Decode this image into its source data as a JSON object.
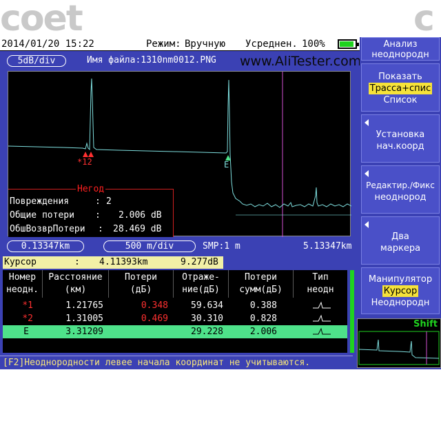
{
  "watermark": {
    "left": "coet",
    "right": "c"
  },
  "status": {
    "datetime": "2014/01/20 15:22",
    "mode_label": "Режим:",
    "mode_value": "Вручную",
    "avg_label": "Усреднен.",
    "avg_value": "100%"
  },
  "scale": {
    "db_div": "5dB/div",
    "filename_label": "Имя файла:",
    "filename": "1310nm0012.PNG",
    "site": "www.AliTester.com"
  },
  "trace": {
    "marker_left": "*12",
    "marker_e": "E",
    "info_header": "Негод",
    "lines": [
      {
        "label": "Повреждения",
        "sep": ":",
        "value": "2"
      },
      {
        "label": "Общие потери",
        "sep": ":",
        "value": "2.006 dB"
      },
      {
        "label": "ОбшВозврПотери",
        "sep": ":",
        "value": "28.469 dB"
      }
    ]
  },
  "axis": {
    "start": "0.13347km",
    "div": "500 m/div",
    "smp": "SMP:1 m",
    "end": "5.13347km"
  },
  "cursor": {
    "label": "Курсор",
    "sep": ":",
    "distance": "4.11393km",
    "value": "9.277dB"
  },
  "table": {
    "headers": [
      [
        "Номер",
        "неодн."
      ],
      [
        "Расстояние",
        "(км)"
      ],
      [
        "Потери",
        "(дБ)"
      ],
      [
        "Отраже-",
        "ние(дБ)"
      ],
      [
        "Потери",
        "сумм(дБ)"
      ],
      [
        "Тип",
        "неодн"
      ]
    ],
    "rows": [
      {
        "num": "*1",
        "dist": "1.21765",
        "loss": "0.348",
        "refl": "59.634",
        "sum": "0.388"
      },
      {
        "num": "*2",
        "dist": "1.31005",
        "loss": "0.469",
        "refl": "30.310",
        "sum": "0.828"
      },
      {
        "num": "E",
        "dist": "3.31209",
        "loss": "",
        "refl": "29.228",
        "sum": "2.006"
      }
    ]
  },
  "hint": "[F2]Неоднородности левее начала координат не учитываются.",
  "softkeys": {
    "k1": {
      "l1": "Анализ",
      "l2": "неоднородн"
    },
    "k2": {
      "l1": "Показать",
      "hl": "Трасса+спис",
      "l3": "Список"
    },
    "k3": {
      "l1": "Установка",
      "l2": "нач.коорд"
    },
    "k4": {
      "l1": "Редактир./Фикс",
      "l2": "неоднород"
    },
    "k5": {
      "l1": "Два",
      "l2": "маркера"
    },
    "k6": {
      "l1": "Манипулятор",
      "hl": "Курсор",
      "l3": "Неоднородн"
    }
  },
  "mini": {
    "shift": "Shift"
  },
  "colors": {
    "screen_bg": "#3b41b4",
    "trace": "#7fe0e0",
    "cursor_line": "#d050d0",
    "loss_red": "#ff3030",
    "selected_row": "#4ee28a",
    "highlight": "#f6e23a"
  }
}
